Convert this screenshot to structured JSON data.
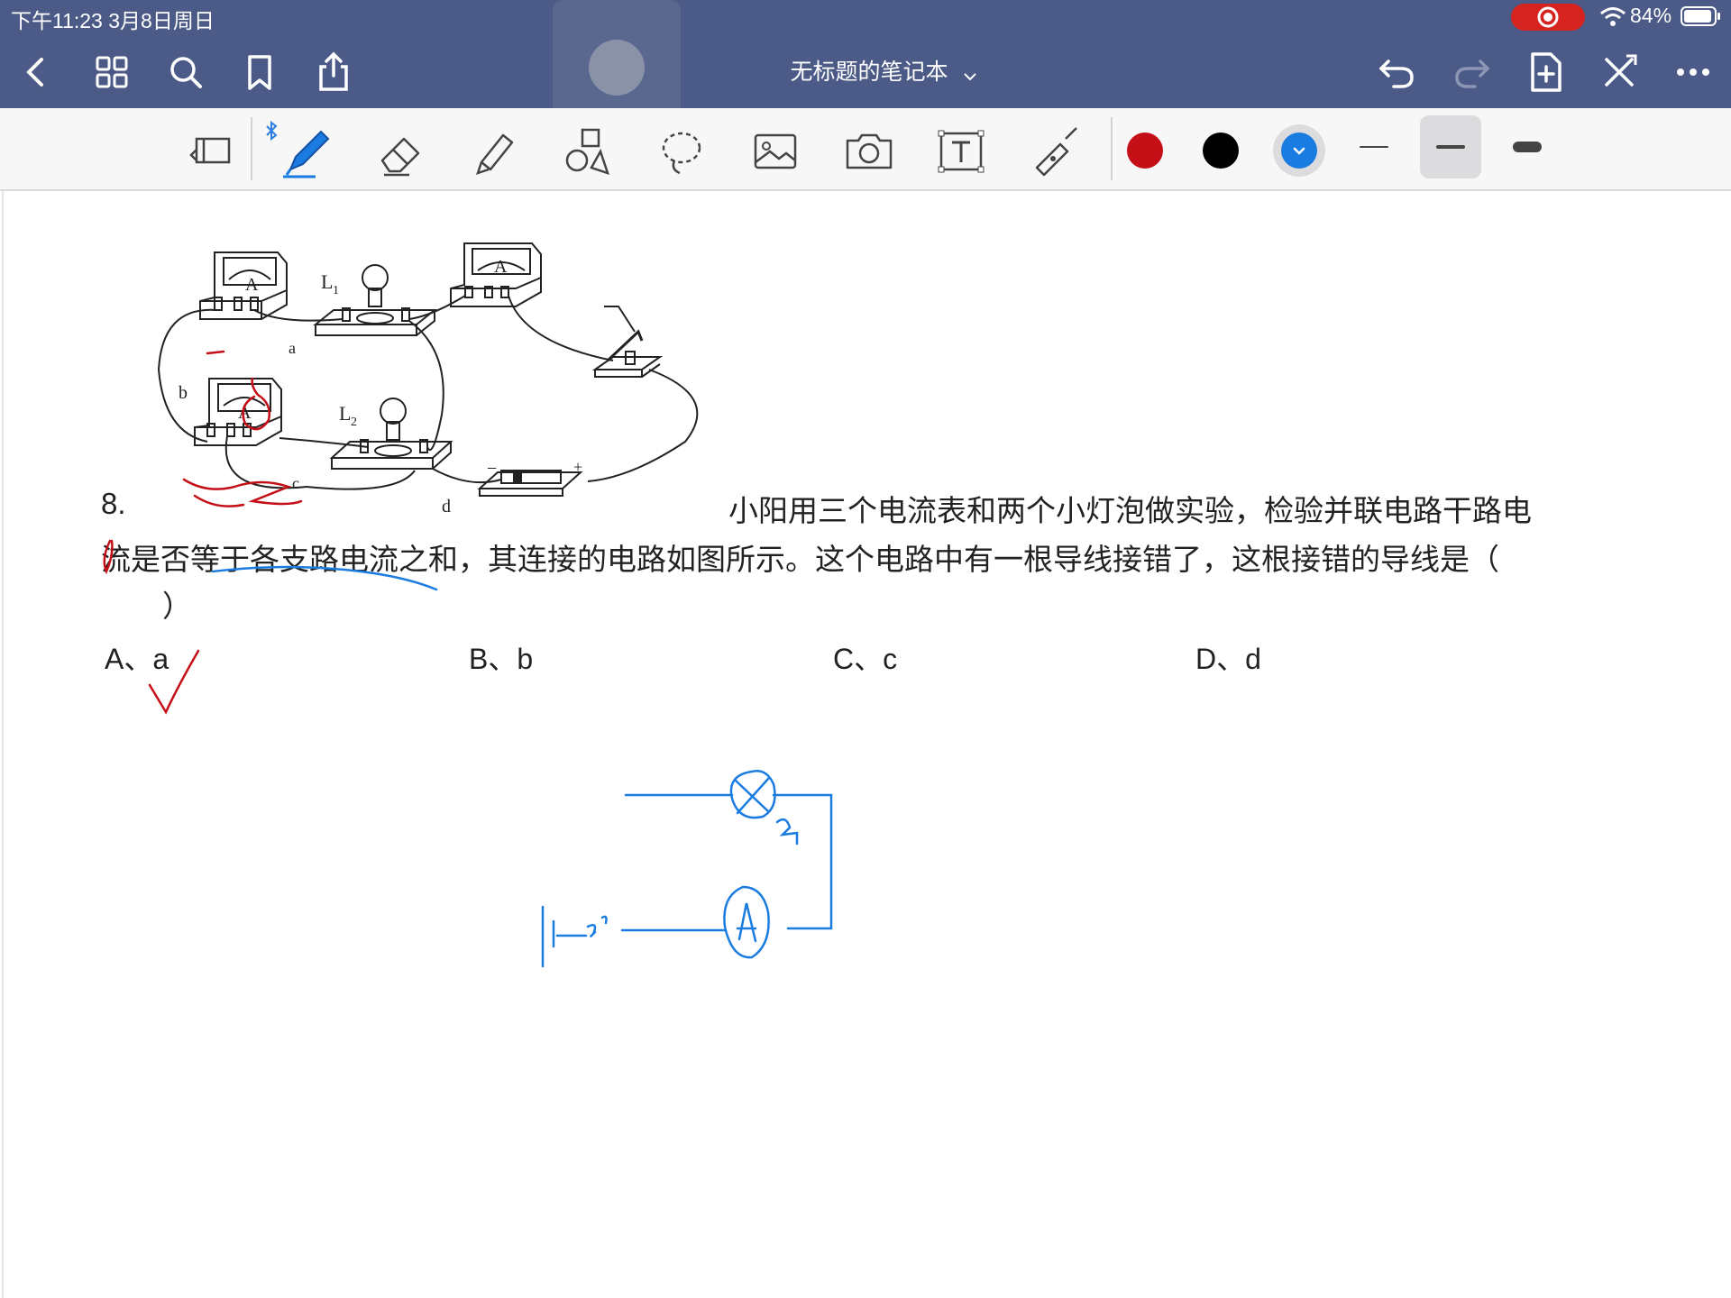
{
  "status_bar": {
    "time_date": "下午11:23   3月8日周日",
    "battery": "84%"
  },
  "header": {
    "title": "无标题的笔记本",
    "icons": [
      "back-icon",
      "grid-icon",
      "search-icon",
      "bookmark-icon",
      "share-icon",
      "undo-icon",
      "redo-icon",
      "add-page-icon",
      "close-icon",
      "more-icon"
    ]
  },
  "toolbar": {
    "tools": [
      "read-mode-icon",
      "pen-icon",
      "eraser-icon",
      "highlighter-icon",
      "shapes-icon",
      "lasso-icon",
      "image-icon",
      "camera-icon",
      "text-icon",
      "laser-pointer-icon"
    ],
    "colors": [
      "#c40f17",
      "#000000",
      "#1a7ce0"
    ],
    "selected_color": "#1a7ce0"
  },
  "question": {
    "number": "8.",
    "line1": "小阳用三个电流表和两个小灯泡做实验，检验并联电路干路电",
    "line2": "流是否等于各支路电流之和，其连接的电路如图所示。这个电路中有一根导线接错了，这根接错的导线是（",
    "line3": "）",
    "choices": [
      "A、a",
      "B、b",
      "C、c",
      "D、d"
    ]
  },
  "diagram": {
    "labels": {
      "l1": "L",
      "l1_sub": "1",
      "l2": "L",
      "l2_sub": "2",
      "a": "a",
      "b": "b",
      "c": "c",
      "d": "d",
      "ammeter": "A",
      "minus": "−",
      "plus": "+"
    }
  }
}
